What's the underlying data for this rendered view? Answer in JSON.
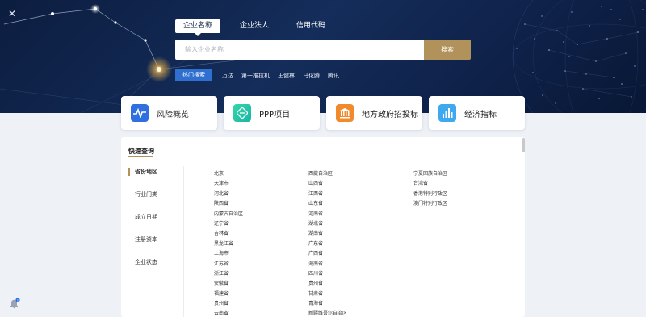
{
  "header": {
    "close_glyph": "✕",
    "tabs": [
      {
        "label": "企业名称",
        "active": true
      },
      {
        "label": "企业法人",
        "active": false
      },
      {
        "label": "信用代码",
        "active": false
      }
    ],
    "search": {
      "placeholder": "输入企业名称",
      "button_label": "搜索"
    },
    "hot": {
      "label": "热门搜索",
      "keywords": [
        "万达",
        "第一推拉机",
        "王健林",
        "马化腾",
        "腾讯"
      ]
    }
  },
  "cards": [
    {
      "label": "风险概览",
      "icon": "pulse-icon",
      "color": "#2f6fe0"
    },
    {
      "label": "PPP项目",
      "icon": "handshake-icon",
      "color": "#1fc6a6"
    },
    {
      "label": "地方政府招投标",
      "icon": "government-building-icon",
      "color": "#f08a2c"
    },
    {
      "label": "经济指标",
      "icon": "bar-chart-icon",
      "color": "#3fa9f0"
    }
  ],
  "quick_query": {
    "title": "快速查询",
    "sidebar": [
      {
        "label": "省份地区",
        "active": true
      },
      {
        "label": "行业门类",
        "active": false
      },
      {
        "label": "成立日期",
        "active": false
      },
      {
        "label": "注册资本",
        "active": false
      },
      {
        "label": "企业状态",
        "active": false
      }
    ],
    "regions": [
      [
        "北京",
        "天津市",
        "河北省",
        "陕西省",
        "内蒙古自治区",
        "辽宁省",
        "吉林省",
        "黑龙江省",
        "上海市",
        "江苏省",
        "浙江省",
        "安徽省",
        "福建省",
        "贵州省",
        "云南省"
      ],
      [
        "西藏自治区",
        "山西省",
        "江西省",
        "山东省",
        "河南省",
        "湖北省",
        "湖南省",
        "广东省",
        "广西省",
        "海南省",
        "四川省",
        "贵州省",
        "甘肃省",
        "青海省",
        "新疆维吾尔自治区"
      ],
      [
        "宁夏回族自治区",
        "台湾省",
        "香港特别行政区",
        "澳门特别行政区"
      ]
    ]
  },
  "footer": {
    "notification_count": "1"
  }
}
